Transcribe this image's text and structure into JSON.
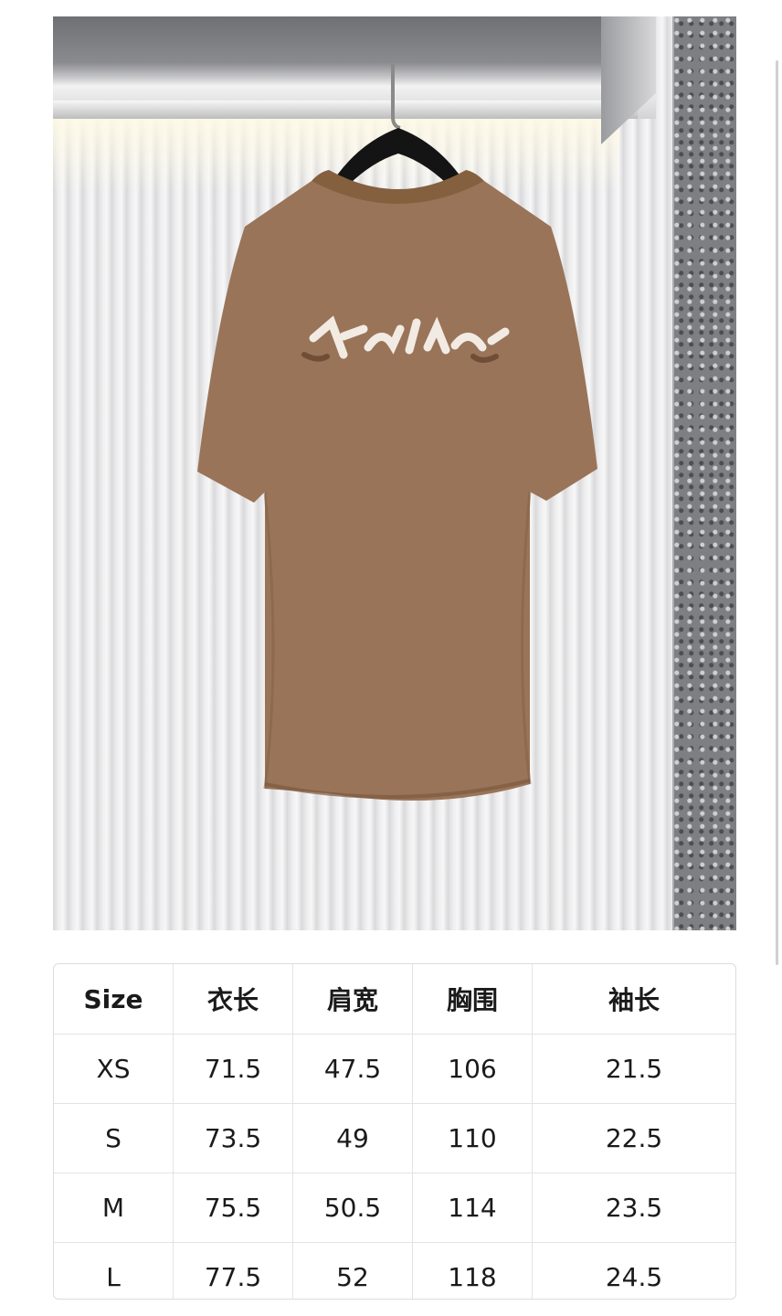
{
  "product_image": {
    "semantic": "brown-tshirt-on-hanger-photo",
    "shirt_color": "#9a7458",
    "logo_color": "#f1ebe4"
  },
  "size_table": {
    "headers": [
      "Size",
      "衣长",
      "肩宽",
      "胸围",
      "袖长"
    ],
    "rows": [
      [
        "XS",
        "71.5",
        "47.5",
        "106",
        "21.5"
      ],
      [
        "S",
        "73.5",
        "49",
        "110",
        "22.5"
      ],
      [
        "M",
        "75.5",
        "50.5",
        "114",
        "23.5"
      ],
      [
        "L",
        "77.5",
        "52",
        "118",
        "24.5"
      ]
    ]
  }
}
